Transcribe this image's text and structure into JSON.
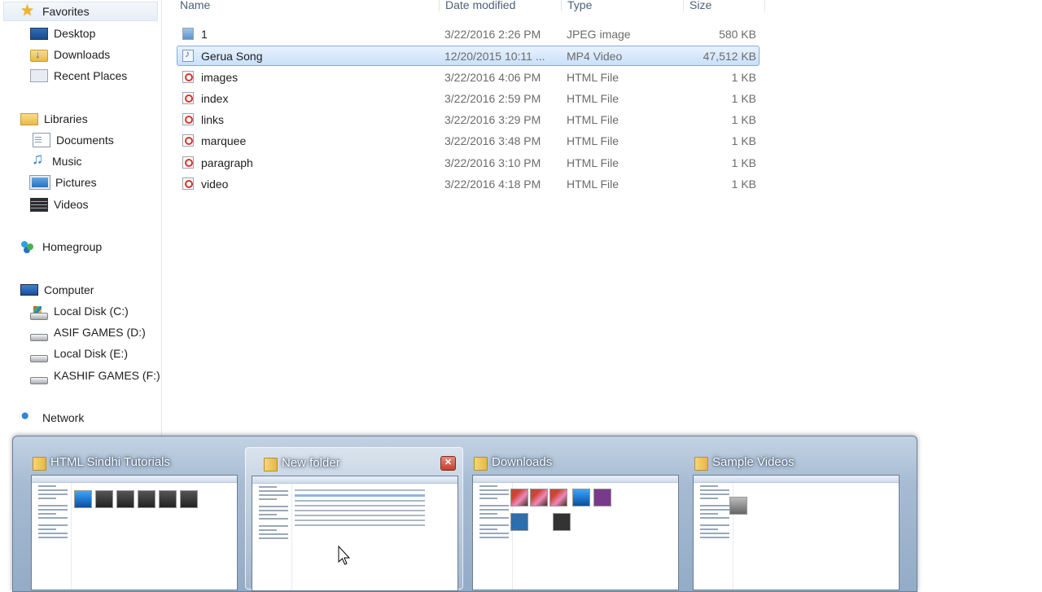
{
  "nav": {
    "items": [
      {
        "label": "Favorites",
        "icon": "star-icon"
      },
      {
        "label": "Desktop",
        "icon": "desktop-icon"
      },
      {
        "label": "Downloads",
        "icon": "downloads-folder-icon"
      },
      {
        "label": "Recent Places",
        "icon": "recent-places-icon"
      },
      {
        "label": "Libraries",
        "icon": "libraries-icon"
      },
      {
        "label": "Documents",
        "icon": "documents-icon"
      },
      {
        "label": "Music",
        "icon": "music-icon"
      },
      {
        "label": "Pictures",
        "icon": "pictures-icon"
      },
      {
        "label": "Videos",
        "icon": "videos-icon"
      },
      {
        "label": "Homegroup",
        "icon": "homegroup-icon"
      },
      {
        "label": "Computer",
        "icon": "computer-icon"
      },
      {
        "label": "Local Disk (C:)",
        "icon": "system-drive-icon"
      },
      {
        "label": "ASIF GAMES (D:)",
        "icon": "drive-icon"
      },
      {
        "label": "Local Disk (E:)",
        "icon": "drive-icon"
      },
      {
        "label": "KASHIF GAMES (F:)",
        "icon": "drive-icon"
      },
      {
        "label": "Network",
        "icon": "network-icon"
      }
    ]
  },
  "columns": {
    "name": "Name",
    "date": "Date modified",
    "type": "Type",
    "size": "Size"
  },
  "files": [
    {
      "name": "1",
      "date": "3/22/2016 2:26 PM",
      "type": "JPEG image",
      "size": "580 KB",
      "icon": "jpeg-file-icon"
    },
    {
      "name": "Gerua Song",
      "date": "12/20/2015 10:11 ...",
      "type": "MP4 Video",
      "size": "47,512 KB",
      "icon": "mp4-file-icon",
      "selected": true
    },
    {
      "name": "images",
      "date": "3/22/2016 4:06 PM",
      "type": "HTML File",
      "size": "1 KB",
      "icon": "html-file-icon"
    },
    {
      "name": "index",
      "date": "3/22/2016 2:59 PM",
      "type": "HTML File",
      "size": "1 KB",
      "icon": "html-file-icon"
    },
    {
      "name": "links",
      "date": "3/22/2016 3:29 PM",
      "type": "HTML File",
      "size": "1 KB",
      "icon": "html-file-icon"
    },
    {
      "name": "marquee",
      "date": "3/22/2016 3:48 PM",
      "type": "HTML File",
      "size": "1 KB",
      "icon": "html-file-icon"
    },
    {
      "name": "paragraph",
      "date": "3/22/2016 3:10 PM",
      "type": "HTML File",
      "size": "1 KB",
      "icon": "html-file-icon"
    },
    {
      "name": "video",
      "date": "3/22/2016 4:18 PM",
      "type": "HTML File",
      "size": "1 KB",
      "icon": "html-file-icon"
    }
  ],
  "taskbar_thumbnails": [
    {
      "title": "HTML Sindhi Tutorials",
      "icon": "folder-icon"
    },
    {
      "title": "New folder",
      "icon": "folder-icon",
      "hovered": true,
      "close_icon": "close-icon"
    },
    {
      "title": "Downloads",
      "icon": "folder-icon"
    },
    {
      "title": "Sample Videos",
      "icon": "folder-icon"
    }
  ]
}
